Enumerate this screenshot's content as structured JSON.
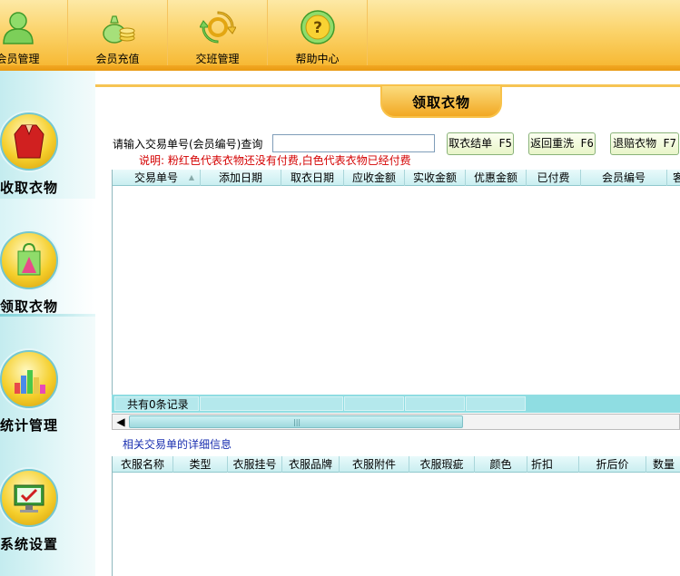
{
  "toolbar": {
    "items": [
      {
        "label": "会员管理",
        "icon": "member-icon"
      },
      {
        "label": "会员充值",
        "icon": "money-bag-icon"
      },
      {
        "label": "交班管理",
        "icon": "refresh-cycle-icon"
      },
      {
        "label": "帮助中心",
        "icon": "help-icon"
      }
    ]
  },
  "sidebar": {
    "items": [
      {
        "label": "收取衣物",
        "icon": "robe-icon"
      },
      {
        "label": "领取衣物",
        "icon": "shopping-bag-icon",
        "active": true
      },
      {
        "label": "统计管理",
        "icon": "bar-chart-icon"
      },
      {
        "label": "系统设置",
        "icon": "monitor-settings-icon"
      }
    ]
  },
  "page": {
    "title": "领取衣物"
  },
  "query": {
    "label": "请输入交易单号(会员编号)查询",
    "value": "",
    "note": "说明: 粉红色代表衣物还没有付费,白色代表衣物已经付费"
  },
  "buttons": {
    "take": "取衣结单 F5",
    "rewash": "返回重洗 F6",
    "refund": "退赔衣物 F7"
  },
  "main_grid": {
    "columns": [
      "交易单号",
      "添加日期",
      "取衣日期",
      "应收金额",
      "实收金额",
      "优惠金额",
      "已付费",
      "会员编号",
      "客"
    ],
    "sort_marker": "▲",
    "record_count": "共有0条记录"
  },
  "detail": {
    "title": "相关交易单的详细信息",
    "columns": [
      "衣服名称",
      "类型",
      "衣服挂号",
      "衣服品牌",
      "衣服附件",
      "衣服瑕疵",
      "颜色",
      "折扣",
      "折后价",
      "数量"
    ]
  },
  "colors": {
    "toolbar_orange": "#f6b52c",
    "sidebar_cyan": "#c4ecef",
    "note_red": "#d40000",
    "link_blue": "#1a2fb0"
  }
}
